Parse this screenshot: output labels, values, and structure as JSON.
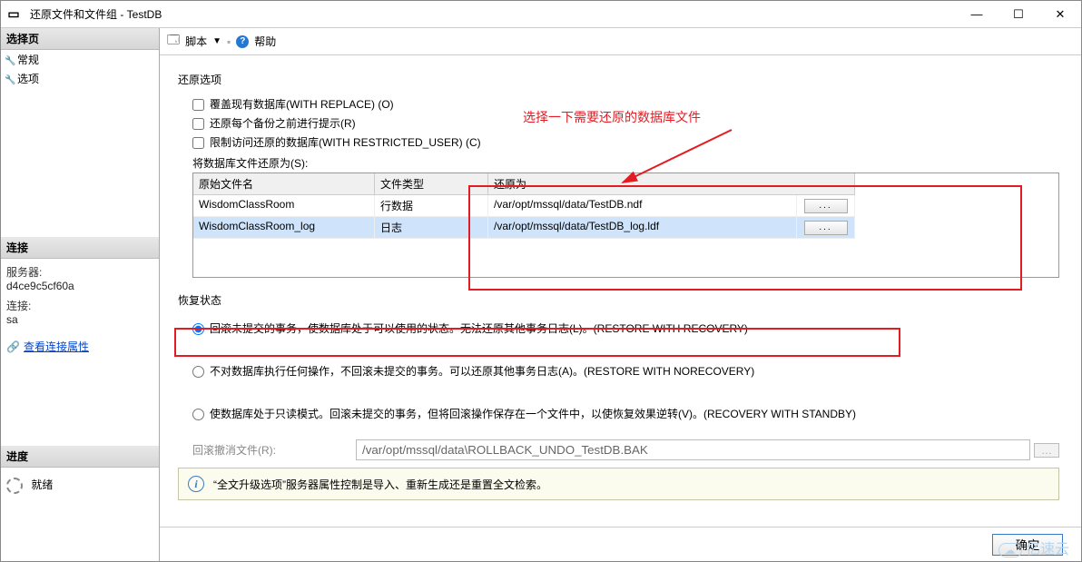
{
  "window": {
    "title": "还原文件和文件组 - TestDB"
  },
  "sidebar": {
    "pages_header": "选择页",
    "pages": [
      {
        "icon": "🔧",
        "label": "常规"
      },
      {
        "icon": "🔧",
        "label": "选项"
      }
    ],
    "connection_header": "连接",
    "server_label": "服务器:",
    "server_value": "d4ce9c5cf60a",
    "conn_label": "连接:",
    "conn_value": "sa",
    "view_conn_props": "查看连接属性",
    "progress_header": "进度",
    "progress_status": "就绪"
  },
  "toolbar": {
    "script_label": "脚本",
    "help_label": "帮助"
  },
  "restore": {
    "options_title": "还原选项",
    "overwrite_label": "覆盖现有数据库(WITH REPLACE) (O)",
    "prompt_label": "还原每个备份之前进行提示(R)",
    "restrict_label": "限制访问还原的数据库(WITH RESTRICTED_USER) (C)",
    "files_label": "将数据库文件还原为(S):",
    "col_orig": "原始文件名",
    "col_type": "文件类型",
    "col_restoreas": "还原为",
    "rows": [
      {
        "orig": "WisdomClassRoom",
        "type": "行数据",
        "restoreas": "/var/opt/mssql/data/TestDB.ndf",
        "selected": false
      },
      {
        "orig": "WisdomClassRoom_log",
        "type": "日志",
        "restoreas": "/var/opt/mssql/data/TestDB_log.ldf",
        "selected": true
      }
    ]
  },
  "recovery": {
    "title": "恢复状态",
    "opt_recovery": "回滚未提交的事务，使数据库处于可以使用的状态。无法还原其他事务日志(L)。(RESTORE WITH RECOVERY)",
    "opt_norecovery": "不对数据库执行任何操作，不回滚未提交的事务。可以还原其他事务日志(A)。(RESTORE WITH NORECOVERY)",
    "opt_standby": "使数据库处于只读模式。回滚未提交的事务，但将回滚操作保存在一个文件中，以使恢复效果逆转(V)。(RECOVERY WITH STANDBY)",
    "rollback_label": "回滚撤消文件(R):",
    "rollback_value": "/var/opt/mssql/data\\ROLLBACK_UNDO_TestDB.BAK"
  },
  "info": {
    "text": "“全文升级选项”服务器属性控制是导入、重新生成还是重置全文检索。"
  },
  "footer": {
    "ok": "确定"
  },
  "annotation": {
    "text": "选择一下需要还原的数据库文件"
  },
  "watermark": "亿速云"
}
